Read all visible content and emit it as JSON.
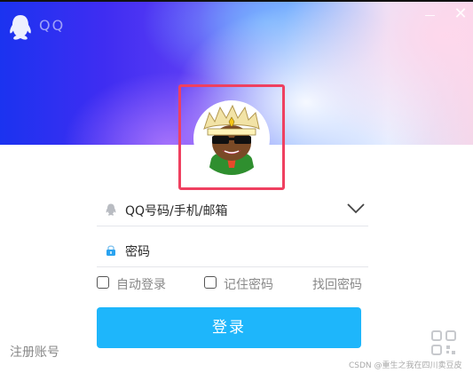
{
  "window": {
    "title": "QQ"
  },
  "login": {
    "account_placeholder": "QQ号码/手机/邮箱",
    "password_placeholder": "密码",
    "auto_login": "自动登录",
    "remember_password": "记住密码",
    "find_password": "找回密码",
    "login_button": "登录",
    "register": "注册账号"
  },
  "watermark": "CSDN @重生之我在四川卖豆皮",
  "icons": {
    "logo": "penguin-logo-icon",
    "minimize": "minimize-icon",
    "close": "close-icon",
    "account": "penguin-user-icon",
    "password": "lock-icon",
    "dropdown": "chevron-down-icon",
    "qr": "qr-code-icon"
  },
  "colors": {
    "primary_button": "#1eb6fb",
    "highlight_box": "#ef4060",
    "banner_left": "#1b33f0",
    "banner_right": "#f4d7ea"
  }
}
